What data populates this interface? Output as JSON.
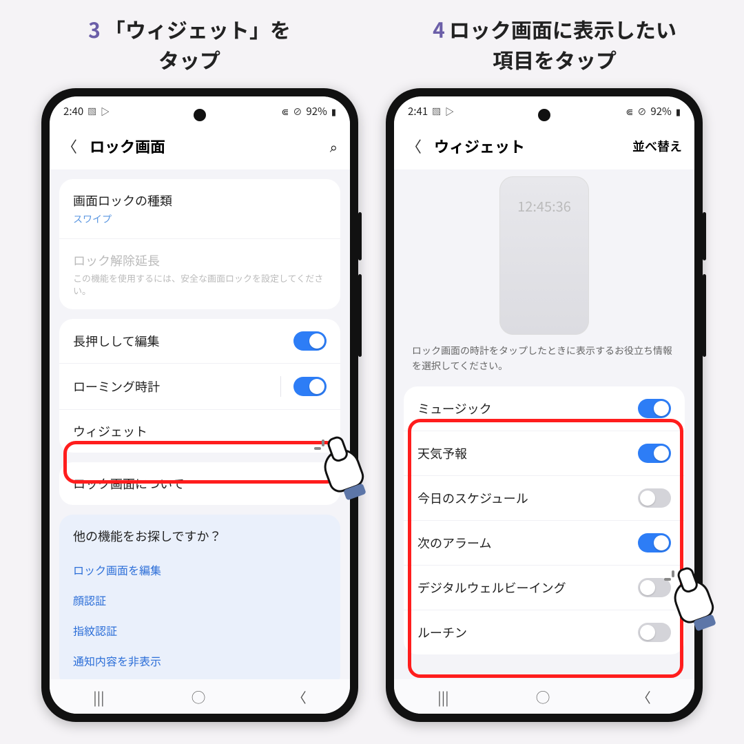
{
  "captions": {
    "step3_num": "3",
    "step3_line1": "「ウィジェット」を",
    "step3_line2": "タップ",
    "step4_num": "4",
    "step4_line1": "ロック画面に表示したい",
    "step4_line2": "項目をタップ"
  },
  "left_screen": {
    "status": {
      "time": "2:40",
      "battery": "92%"
    },
    "appbar_title": "ロック画面",
    "rows": {
      "lock_type_title": "画面ロックの種類",
      "lock_type_sub": "スワイプ",
      "extend_title": "ロック解除延長",
      "extend_sub": "この機能を使用するには、安全な画面ロックを設定してください。",
      "longpress_title": "長押しして編集",
      "roaming_title": "ローミング時計",
      "widget_title": "ウィジェット",
      "about_title": "ロック画面について"
    },
    "footer": {
      "title": "他の機能をお探しですか？",
      "link1": "ロック画面を編集",
      "link2": "顔認証",
      "link3": "指紋認証",
      "link4": "通知内容を非表示"
    }
  },
  "right_screen": {
    "status": {
      "time": "2:41",
      "battery": "92%"
    },
    "appbar_title": "ウィジェット",
    "appbar_right": "並べ替え",
    "preview_time": "12:45:36",
    "hint": "ロック画面の時計をタップしたときに表示するお役立ち情報を選択してください。",
    "items": {
      "music": "ミュージック",
      "weather": "天気予報",
      "schedule": "今日のスケジュール",
      "alarm": "次のアラーム",
      "wellbeing": "デジタルウェルビーイング",
      "routine": "ルーチン"
    }
  }
}
